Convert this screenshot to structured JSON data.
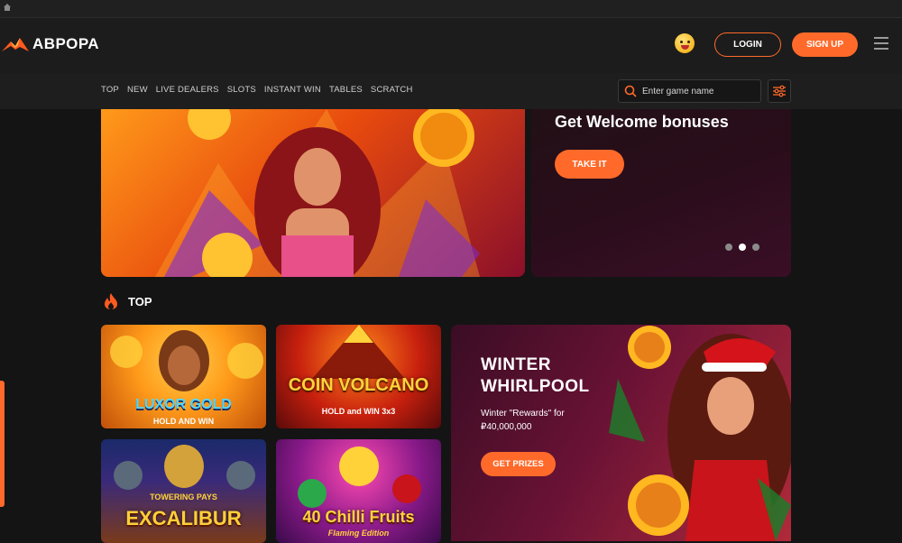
{
  "header": {
    "logo_text": "АВРОРА",
    "login_label": "LOGIN",
    "signup_label": "SIGN UP"
  },
  "nav": {
    "items": [
      "TOP",
      "NEW",
      "LIVE DEALERS",
      "SLOTS",
      "INSTANT WIN",
      "TABLES",
      "SCRATCH"
    ],
    "search_placeholder": "Enter game name"
  },
  "banner": {
    "title": "Get Welcome bonuses",
    "button_label": "TAKE IT",
    "slide_count": 3,
    "active_slide": 2
  },
  "section": {
    "title": "TOP"
  },
  "games": [
    {
      "title": "LUXOR GOLD",
      "subtitle": "HOLD AND WIN"
    },
    {
      "title": "COIN VOLCANO",
      "subtitle": "HOLD and WIN 3x3"
    },
    {
      "title": "EXCALIBUR",
      "subtitle": "TOWERING PAYS"
    },
    {
      "title": "40 Chilli Fruits",
      "subtitle": "Flaming Edition"
    }
  ],
  "promo": {
    "title": "WINTER WHIRLPOOL",
    "subtitle": "Winter \"Rewards\" for ₽40,000,000",
    "button_label": "GET PRIZES"
  },
  "colors": {
    "accent": "#ff6a2a",
    "background": "#141414",
    "header_bg": "#1c1c1c"
  }
}
